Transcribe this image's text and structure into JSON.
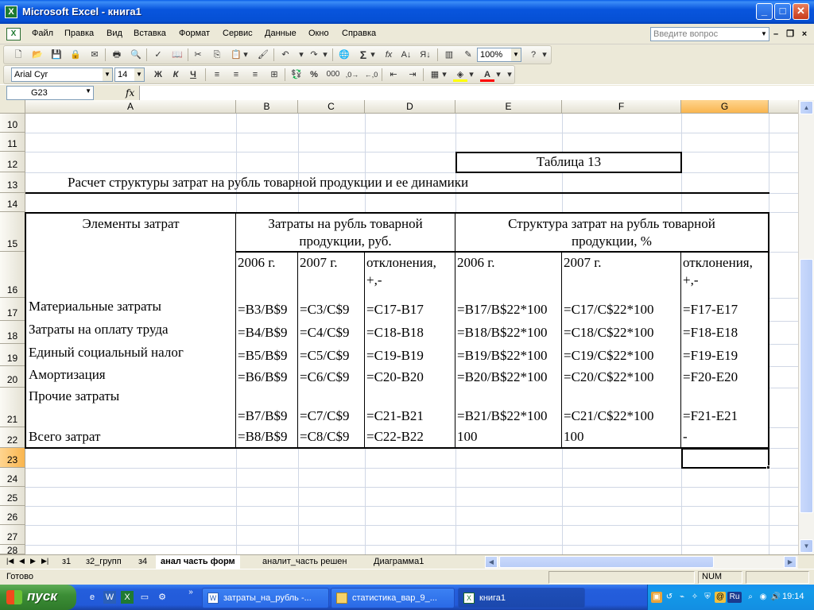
{
  "window": {
    "title": "Microsoft Excel - книга1",
    "app_icon": "X"
  },
  "menu": {
    "items": [
      {
        "label": "Файл"
      },
      {
        "label": "Правка"
      },
      {
        "label": "Вид"
      },
      {
        "label": "Вставка"
      },
      {
        "label": "Формат"
      },
      {
        "label": "Сервис"
      },
      {
        "label": "Данные"
      },
      {
        "label": "Окно"
      },
      {
        "label": "Справка"
      }
    ],
    "ask_placeholder": "Введите вопрос"
  },
  "toolbar": {
    "zoom": "100%",
    "font_name": "Arial Cyr",
    "font_size": "14",
    "bold": "Ж",
    "italic": "К",
    "underline": "Ч",
    "percent": "%",
    "thousands": "000"
  },
  "formula_bar": {
    "name_box": "G23",
    "fx": "fx",
    "formula": ""
  },
  "columns": [
    "A",
    "B",
    "C",
    "D",
    "E",
    "F",
    "G"
  ],
  "rows": [
    "10",
    "11",
    "12",
    "13",
    "14",
    "15",
    "16",
    "17",
    "18",
    "19",
    "20",
    "21",
    "22",
    "23",
    "24",
    "25",
    "26",
    "27",
    "28"
  ],
  "table": {
    "caption": "Таблица 13",
    "title": "Расчет структуры затрат на рубль товарной продукции и ее динамики",
    "hdr_elements": "Элементы затрат",
    "hdr_costs_l1": "Затраты на рубль товарной",
    "hdr_costs_l2": "продукции, руб.",
    "hdr_struct_l1": "Структура затрат на рубль товарной",
    "hdr_struct_l2": "продукции, %",
    "sub_2006": "2006 г.",
    "sub_2007": "2007 г.",
    "sub_dev_l1": "отклонения,",
    "sub_dev_l2": "+,-",
    "sub_2006b": "2006 г.",
    "sub_2007b": "2007 г.",
    "sub_dev2_l1": "отклонения,",
    "sub_dev2_l2": "+,-",
    "data_rows": [
      {
        "name": "Материальные затраты",
        "b": "=B3/B$9",
        "c": "=C3/C$9",
        "d": "=C17-B17",
        "e": "=B17/B$22*100",
        "f": "=C17/C$22*100",
        "g": "=F17-E17"
      },
      {
        "name": "Затраты на оплату труда",
        "b": "=B4/B$9",
        "c": "=C4/C$9",
        "d": "=C18-B18",
        "e": "=B18/B$22*100",
        "f": "=C18/C$22*100",
        "g": "=F18-E18"
      },
      {
        "name": "Единый социальный налог",
        "b": "=B5/B$9",
        "c": "=C5/C$9",
        "d": "=C19-B19",
        "e": "=B19/B$22*100",
        "f": "=C19/C$22*100",
        "g": "=F19-E19"
      },
      {
        "name": "Амортизация",
        "b": "=B6/B$9",
        "c": "=C6/C$9",
        "d": "=C20-B20",
        "e": "=B20/B$22*100",
        "f": "=C20/C$22*100",
        "g": "=F20-E20"
      },
      {
        "name": "Прочие затраты",
        "b": "=B7/B$9",
        "c": "=C7/C$9",
        "d": "=C21-B21",
        "e": "=B21/B$22*100",
        "f": "=C21/C$22*100",
        "g": "=F21-E21"
      },
      {
        "name": "Всего затрат",
        "b": "=B8/B$9",
        "c": "=C8/C$9",
        "d": "=C22-B22",
        "e": "100",
        "f": "100",
        "g": "-"
      }
    ]
  },
  "sheet_tabs": [
    {
      "label": "з1"
    },
    {
      "label": "з2_групп"
    },
    {
      "label": "з4"
    },
    {
      "label": "анал часть форм"
    },
    {
      "label": "аналит_часть решен"
    },
    {
      "label": "Диаграмма1"
    }
  ],
  "status": {
    "ready": "Готово",
    "num": "NUM"
  },
  "taskbar": {
    "start": "пуск",
    "tasks": [
      {
        "label": "затраты_на_рубль -..."
      },
      {
        "label": "статистика_вар_9_..."
      },
      {
        "label": "книга1"
      }
    ],
    "lang": "Ru",
    "clock": "19:14"
  }
}
